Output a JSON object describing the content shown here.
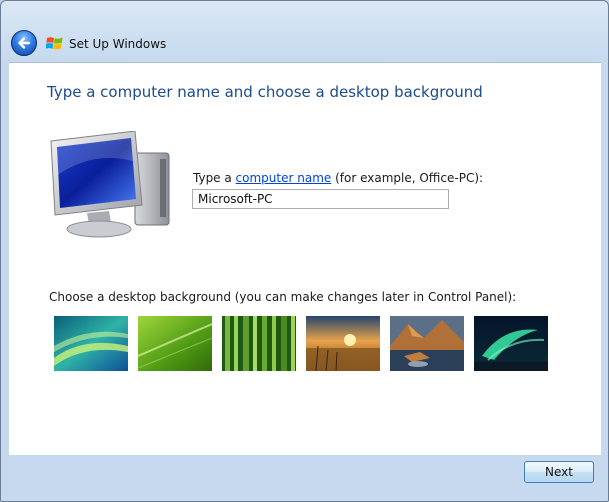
{
  "window": {
    "title": "Set Up Windows",
    "icons": {
      "back": "back-arrow-icon",
      "logo": "windows-logo-icon"
    }
  },
  "main": {
    "heading": "Type a computer name and choose a desktop background",
    "computer_name": {
      "label_prefix": "Type a ",
      "label_link": "computer name",
      "label_suffix": " (for example, Office-PC):",
      "value": "Microsoft-PC"
    },
    "background": {
      "label": "Choose a desktop background (you can make changes later in Control Panel):",
      "thumbnails": [
        "Windows Vista aurora",
        "Green leaf",
        "Bamboo",
        "Sunset field",
        "Rocky lake",
        "Northern lights"
      ]
    }
  },
  "footer": {
    "next_label": "Next"
  },
  "colors": {
    "heading": "#1c4b8f",
    "link": "#0046d5",
    "accent": "#2f7be4"
  }
}
